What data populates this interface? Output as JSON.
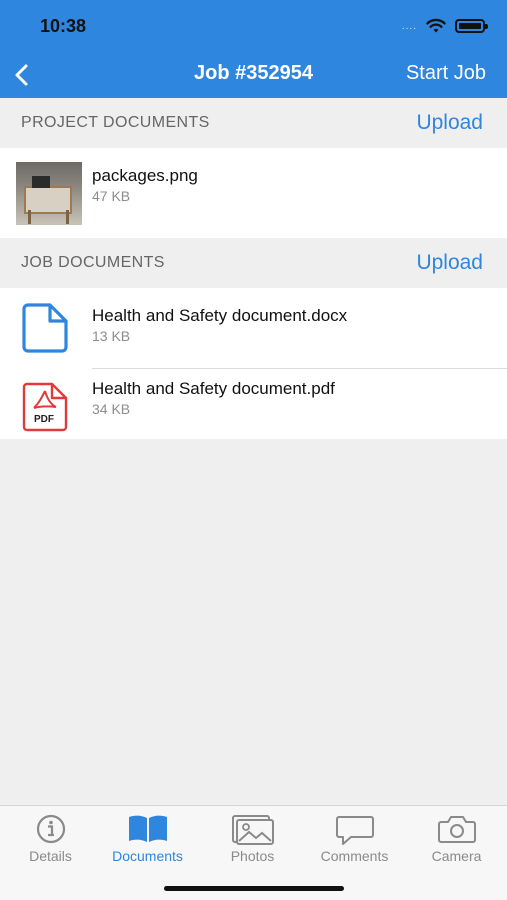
{
  "status_bar": {
    "time": "10:38",
    "dots": "...."
  },
  "nav": {
    "title": "Job #352954",
    "action": "Start Job",
    "back_icon": "chevron-left-icon"
  },
  "project_documents": {
    "title": "PROJECT DOCUMENTS",
    "upload_label": "Upload",
    "files": [
      {
        "name": "packages.png",
        "size": "47 KB",
        "icon": "image-thumbnail"
      }
    ]
  },
  "job_documents": {
    "title": "JOB DOCUMENTS",
    "upload_label": "Upload",
    "files": [
      {
        "name": "Health and Safety document.docx",
        "size": "13 KB",
        "icon": "document-icon"
      },
      {
        "name": "Health and Safety document.pdf",
        "size": "34 KB",
        "icon": "pdf-icon",
        "icon_text": "PDF"
      }
    ]
  },
  "tabs": [
    {
      "label": "Details",
      "icon": "info-icon",
      "active": false
    },
    {
      "label": "Documents",
      "icon": "book-icon",
      "active": true
    },
    {
      "label": "Photos",
      "icon": "photos-icon",
      "active": false
    },
    {
      "label": "Comments",
      "icon": "comment-icon",
      "active": false
    },
    {
      "label": "Camera",
      "icon": "camera-icon",
      "active": false
    }
  ],
  "colors": {
    "accent": "#2f86de",
    "pdf_red": "#e03a3a",
    "background": "#efeff0"
  }
}
